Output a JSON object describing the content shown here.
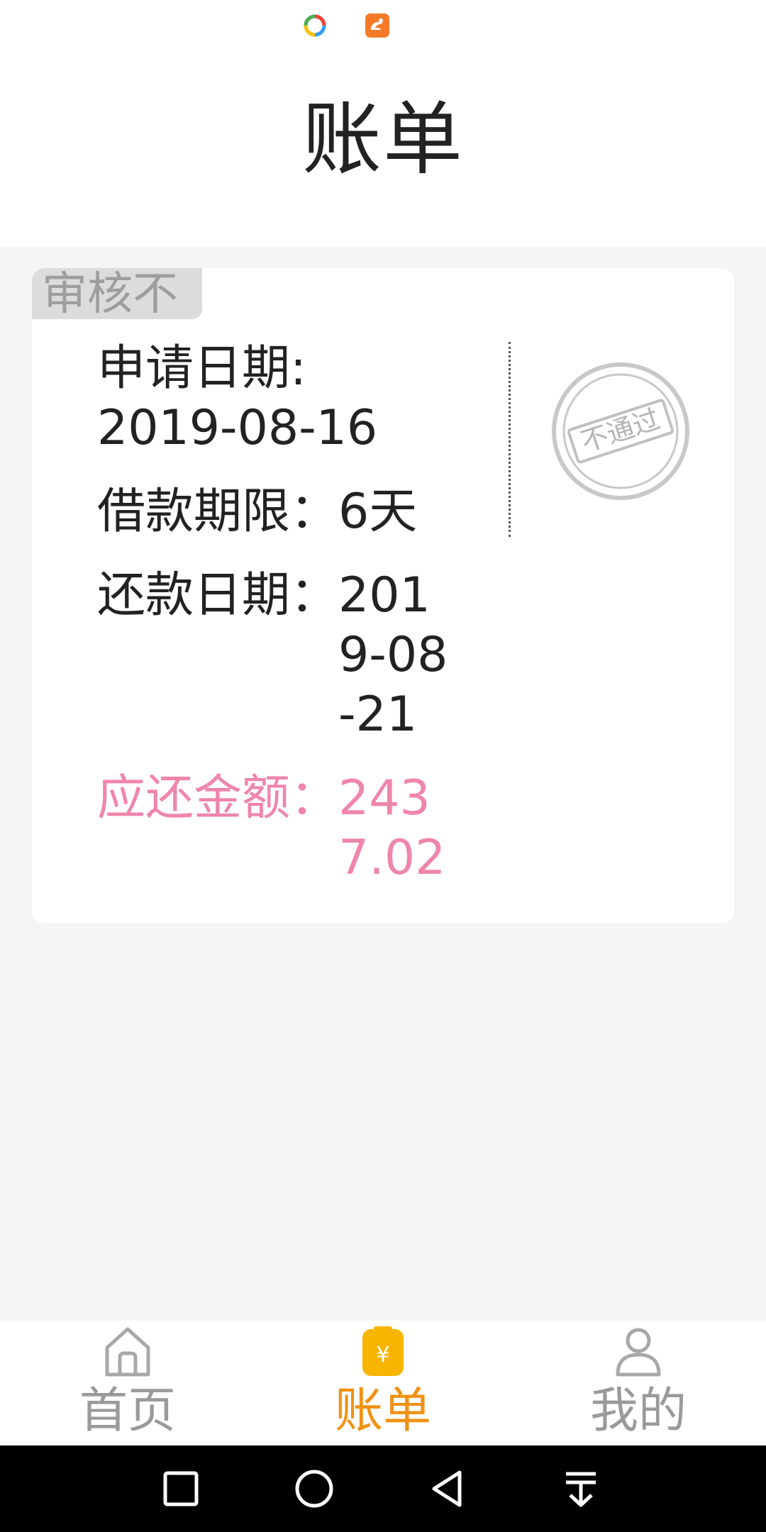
{
  "status_bar": {
    "icons": [
      "browser-app-icon",
      "uc-browser-icon"
    ]
  },
  "header": {
    "title": "账单"
  },
  "bill_card": {
    "status_tag": "审核不",
    "apply_date_label": "申请日期:",
    "apply_date_value": "2019-08-16",
    "loan_term_label": "借款期限：",
    "loan_term_value": "6天",
    "repay_date_label": "还款日期：",
    "repay_date_value": "2019-08-21",
    "amount_due_label": "应还金额：",
    "amount_due_value": "2437.02",
    "stamp_text": "不通过",
    "colors": {
      "amount": "#ef85ad",
      "stamp": "#c8c8c8"
    }
  },
  "tab_bar": {
    "tabs": [
      {
        "label": "首页",
        "icon": "home-icon",
        "active": false
      },
      {
        "label": "账单",
        "icon": "bill-icon",
        "active": true
      },
      {
        "label": "我的",
        "icon": "user-icon",
        "active": false
      }
    ],
    "active_color": "#f29113",
    "inactive_color": "#9a9a9a"
  },
  "nav_bar": {
    "buttons": [
      "recent-apps-icon",
      "home-circle-icon",
      "back-icon",
      "notification-pull-icon"
    ]
  }
}
